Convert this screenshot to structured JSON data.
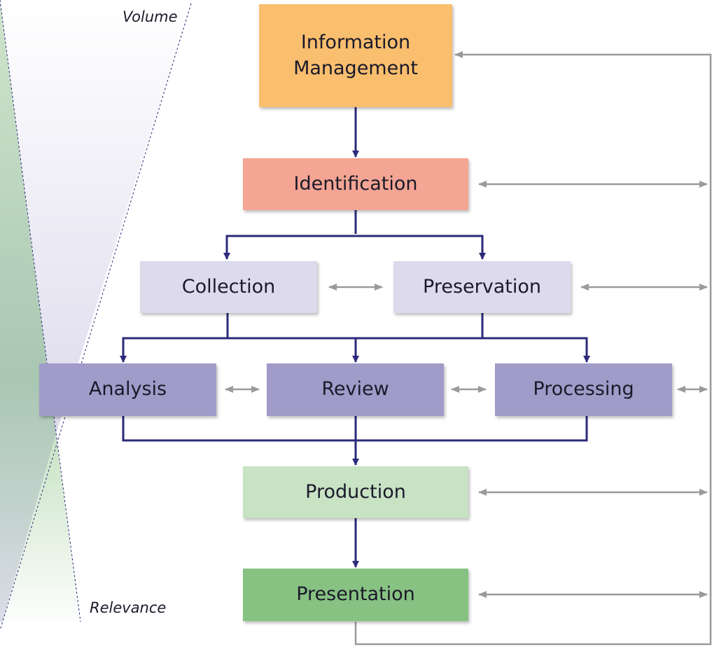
{
  "labels": {
    "volume": "Volume",
    "relevance": "Relevance"
  },
  "stages": {
    "information_management": "Information Management",
    "identification": "Identification",
    "collection": "Collection",
    "preservation": "Preservation",
    "analysis": "Analysis",
    "review": "Review",
    "processing": "Processing",
    "production": "Production",
    "presentation": "Presentation"
  },
  "colors": {
    "information_management": "#F9BE6E",
    "identification": "#F4A593",
    "collection_preservation": "#DCDAEC",
    "analysis_review_processing": "#A09BC8",
    "production": "#C8E2C4",
    "presentation": "#88C283",
    "flow_arrow": "#2B2A7A",
    "feedback_arrow": "#9A9A9A"
  }
}
